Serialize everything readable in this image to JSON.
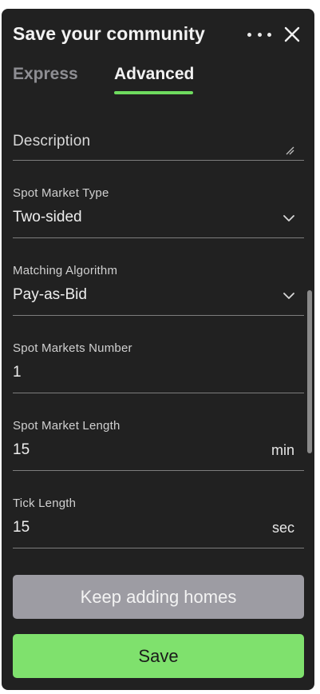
{
  "header": {
    "title": "Save your community"
  },
  "tabs": [
    {
      "label": "Express",
      "active": false
    },
    {
      "label": "Advanced",
      "active": true
    }
  ],
  "fields": {
    "description": {
      "placeholder": "Description"
    },
    "spot_market_type": {
      "label": "Spot Market Type",
      "value": "Two-sided"
    },
    "matching_algorithm": {
      "label": "Matching Algorithm",
      "value": "Pay-as-Bid"
    },
    "spot_markets_number": {
      "label": "Spot Markets Number",
      "value": "1"
    },
    "spot_market_length": {
      "label": "Spot Market Length",
      "value": "15",
      "unit": "min"
    },
    "tick_length": {
      "label": "Tick Length",
      "value": "15",
      "unit": "sec"
    }
  },
  "buttons": {
    "keep_adding": "Keep adding homes",
    "save": "Save"
  },
  "colors": {
    "panel_bg": "#212121",
    "accent_green": "#6fdc5f",
    "save_button": "#7fe16d",
    "secondary_button": "#9d9ca3"
  },
  "icons": {
    "more": "more-horizontal-icon",
    "close": "close-icon",
    "dropdown": "chevron-down-icon",
    "resize": "resize-handle-icon"
  }
}
